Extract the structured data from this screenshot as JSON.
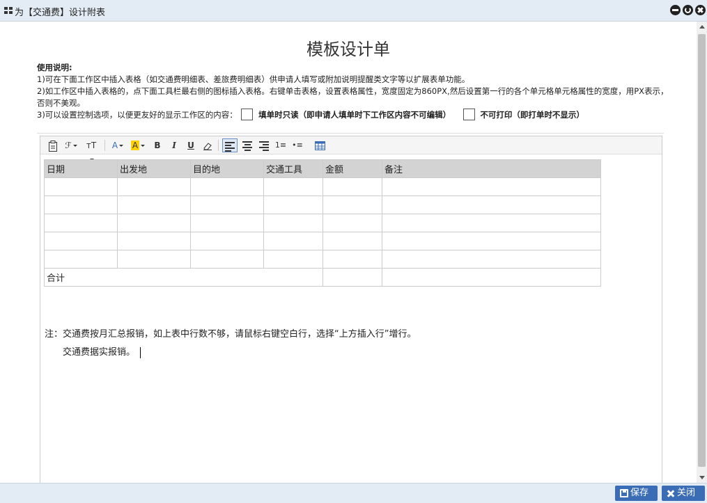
{
  "window": {
    "title": "为【交通费】设计附表"
  },
  "page": {
    "title": "模板设计单",
    "instructions": {
      "heading": "使用说明:",
      "line1": "1)可在下面工作区中插入表格（如交通费明细表、差旅费明细表）供申请人填写或附加说明提醒类文字等以扩展表单功能。",
      "line2": "2)如工作区中插入表格的，点下面工具栏最右侧的图标插入表格。右键单击表格，设置表格属性，宽度固定为860PX,然后设置第一行的各个单元格单元格属性的宽度，用PX表示，否则不美观。",
      "line3": "3)可以设置控制选项，以便更友好的显示工作区的内容：",
      "option_readonly": "填单时只读（即申请人填单时下工作区内容不可编辑）",
      "option_noprint": "不可打印（即打单时不显示）"
    }
  },
  "toolbar": {
    "items": [
      {
        "name": "paste-icon",
        "label": "📋"
      },
      {
        "name": "font-family-icon",
        "label": "ℱ"
      },
      {
        "name": "font-size-icon",
        "label": "тT"
      },
      {
        "name": "font-color-icon",
        "label": "A"
      },
      {
        "name": "highlight-icon",
        "label": "A"
      },
      {
        "name": "bold-icon",
        "label": "B"
      },
      {
        "name": "italic-icon",
        "label": "I"
      },
      {
        "name": "underline-icon",
        "label": "U"
      },
      {
        "name": "eraser-icon",
        "label": "⌫"
      },
      {
        "name": "align-left-icon",
        "label": ""
      },
      {
        "name": "align-center-icon",
        "label": ""
      },
      {
        "name": "align-right-icon",
        "label": ""
      },
      {
        "name": "ordered-list-icon",
        "label": "1≡"
      },
      {
        "name": "unordered-list-icon",
        "label": "•≡"
      },
      {
        "name": "insert-table-icon",
        "label": "▦"
      }
    ]
  },
  "table": {
    "headers": [
      "日期",
      "出发地",
      "目的地",
      "交通工具",
      "金额",
      "备注"
    ],
    "empty_rows": 5,
    "total_label": "合计"
  },
  "notes": {
    "note1": "注：交通费按月汇总报销，如上表中行数不够，请鼠标右键空白行，选择“上方插入行”增行。",
    "note2": "交通费据实报销。"
  },
  "footer": {
    "save_label": "保存",
    "close_label": "关闭"
  },
  "colors": {
    "accent": "#3a6db5",
    "titlebar": "#e3ecf5",
    "table_header": "#d3d3d3"
  }
}
